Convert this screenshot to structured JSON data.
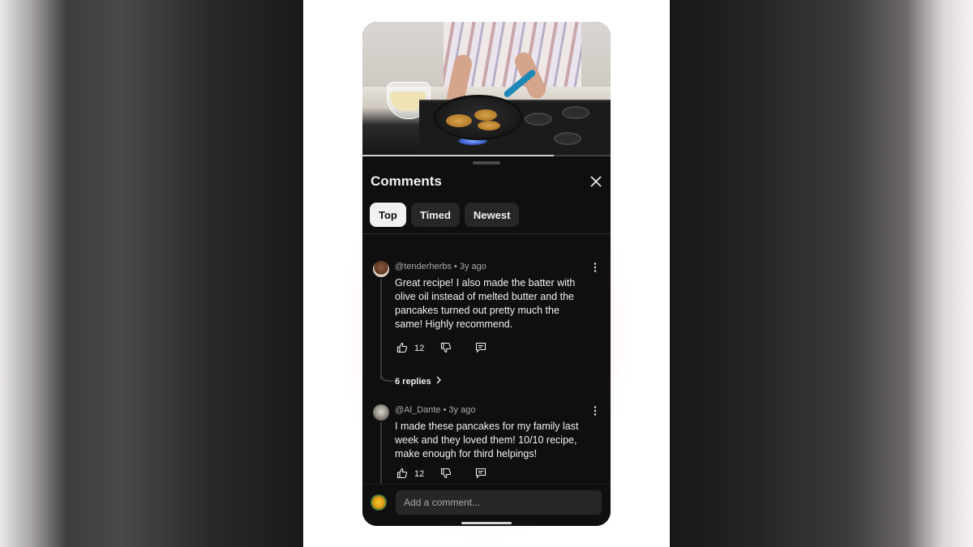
{
  "comments_panel": {
    "title": "Comments",
    "sort_chips": [
      {
        "label": "Top",
        "active": true
      },
      {
        "label": "Timed",
        "active": false
      },
      {
        "label": "Newest",
        "active": false
      }
    ],
    "comments": [
      {
        "author": "@tenderherbs",
        "age": "3y ago",
        "text": "Great recipe! I also made the batter with olive oil instead of melted butter and the pancakes turned out pretty much the same! Highly recommend.",
        "likes": "12",
        "replies_label": "6 replies"
      },
      {
        "author": "@Al_Dante",
        "age": "3y ago",
        "text": "I made these pancakes for my family last week and they loved them! 10/10 recipe, make enough for third helpings!",
        "likes": "12"
      }
    ],
    "composer": {
      "placeholder": "Add a comment..."
    }
  },
  "video": {
    "progress": 0.77
  },
  "icons": {
    "close": "close-icon",
    "more": "more-vert-icon",
    "like": "thumb-up-icon",
    "dislike": "thumb-down-icon",
    "reply": "reply-icon",
    "chevron": "chevron-right-icon"
  },
  "colors": {
    "sheet_bg": "#0f0f0f",
    "chip_bg": "#272727",
    "chip_active_bg": "#f1f1f1",
    "text_primary": "#f1f1f1",
    "text_secondary": "#aaaaaa"
  }
}
